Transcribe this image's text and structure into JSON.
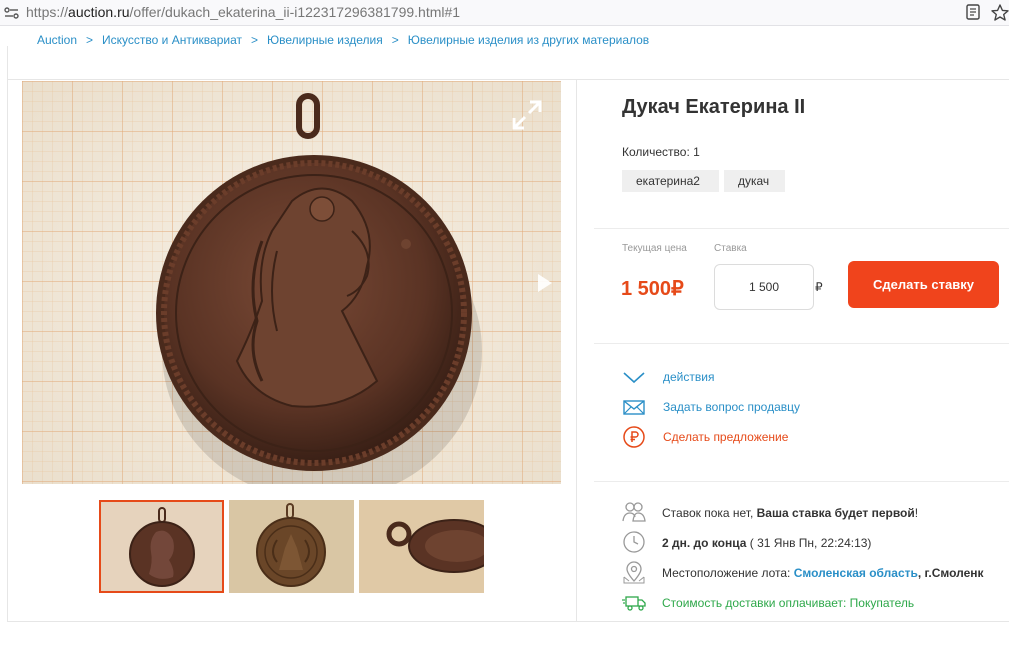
{
  "browser": {
    "url_prefix": "https://",
    "url_domain": "auction.ru",
    "url_path": "/offer/dukach_ekaterina_ii-i122317296381799.html#1"
  },
  "breadcrumb": [
    "Auction",
    "Искусство и Антиквариат",
    "Ювелирные изделия",
    "Ювелирные изделия из других материалов"
  ],
  "breadcrumb_sep": ">",
  "lot": {
    "title": "Дукач Екатерина II",
    "quantity_label": "Количество: 1",
    "tags": [
      "екатерина2",
      "дукач"
    ]
  },
  "pricing": {
    "current_label": "Текущая цена",
    "bid_label": "Ставка",
    "price": "1 500₽",
    "bid_value": "1 500",
    "currency": "₽",
    "bid_button": "Сделать ставку"
  },
  "actions": [
    {
      "label": "действия",
      "icon": "chevron-down-icon",
      "color": "blue"
    },
    {
      "label": "Задать вопрос продавцу",
      "icon": "envelope-icon",
      "color": "blue"
    },
    {
      "label": "Сделать предложение",
      "icon": "ruble-circle-icon",
      "color": "red"
    }
  ],
  "info": {
    "bids_prefix": "Ставок пока нет, ",
    "bids_bold": "Ваша ставка будет первой",
    "bids_suffix": "!",
    "time_bold": "2 дн. до конца",
    "time_rest": " ( 31 Янв Пн, 22:24:13)",
    "location_prefix": "Местоположение лота: ",
    "location_region": "Смоленская область",
    "location_city": ", г.Смоленк",
    "delivery": "Стоимость доставки оплачивает: Покупатель"
  },
  "colors": {
    "accent": "#f0441c",
    "link": "#2a8fc7",
    "price": "#e64a19",
    "delivery": "#2ea84a"
  }
}
